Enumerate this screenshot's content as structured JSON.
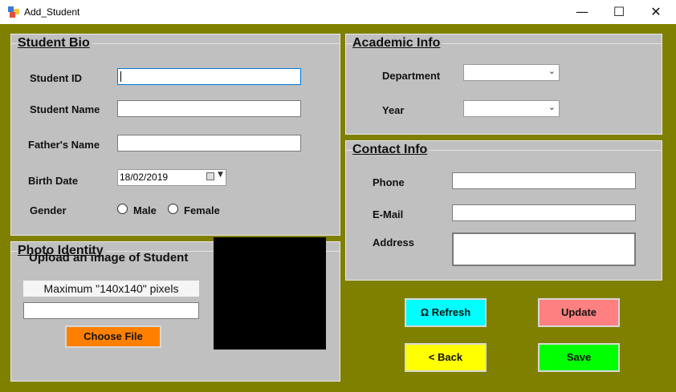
{
  "window": {
    "title": "Add_Student",
    "minimize": "—",
    "maximize": "☐",
    "close": "✕"
  },
  "bio": {
    "title": "Student Bio",
    "student_id_label": "Student ID",
    "student_name_label": "Student Name",
    "fathers_name_label": "Father's Name",
    "birth_date_label": "Birth Date",
    "birth_date_value": "18/02/2019",
    "gender_label": "Gender",
    "gender_male": "Male",
    "gender_female": "Female"
  },
  "academic": {
    "title": "Academic Info",
    "department_label": "Department",
    "year_label": "Year"
  },
  "contact": {
    "title": "Contact Info",
    "phone_label": "Phone",
    "email_label": "E-Mail",
    "address_label": "Address"
  },
  "photo": {
    "title": "Photo Identity",
    "upload_text": "Upload an image of Student",
    "max_text": "Maximum \"140x140\" pixels",
    "choose_label": "Choose File"
  },
  "buttons": {
    "refresh": "Ω  Refresh",
    "update": "Update",
    "back": "<  Back",
    "save": "Save"
  },
  "colors": {
    "background": "#808000",
    "panel": "#c0c0c0",
    "refresh": "#00ffff",
    "update": "#ff8080",
    "back": "#ffff00",
    "save": "#00ff00",
    "choose_file": "#ff8000"
  }
}
